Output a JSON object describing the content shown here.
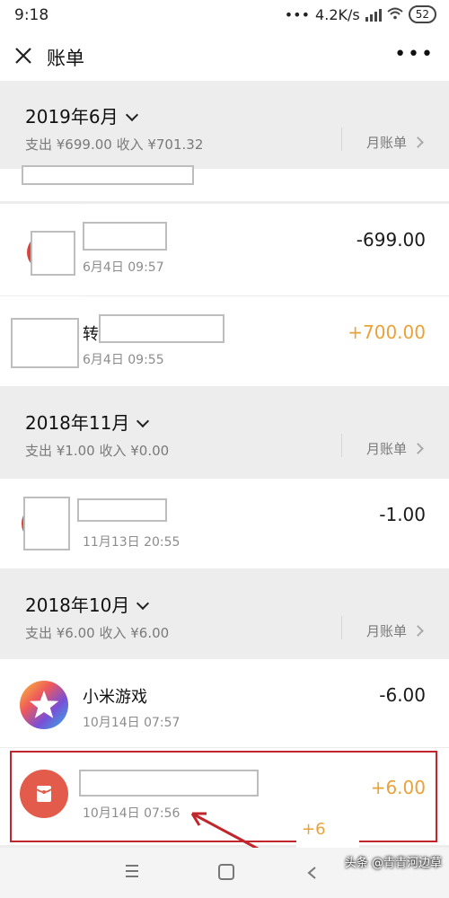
{
  "status": {
    "time": "9:18",
    "speed": "4.2K/s",
    "battery": "52"
  },
  "header": {
    "title": "账单",
    "close_icon": "close-icon",
    "more_icon": "more-icon"
  },
  "groups": [
    {
      "month": "2019年6月",
      "summary": "支出 ¥699.00 收入 ¥701.32",
      "monthly_label": "月账单"
    },
    {
      "month": "2018年11月",
      "summary": "支出 ¥1.00 收入 ¥0.00",
      "monthly_label": "月账单"
    },
    {
      "month": "2018年10月",
      "summary": "支出 ¥6.00 收入 ¥6.00",
      "monthly_label": "月账单"
    }
  ],
  "transactions": [
    {
      "name": "",
      "time": "6月4日 09:57",
      "amount": "-699.00"
    },
    {
      "name": "转",
      "time": "6月4日 09:55",
      "amount": "+700.00"
    },
    {
      "name": "",
      "time": "11月13日 20:55",
      "amount": "-1.00"
    },
    {
      "name": "小米游戏",
      "time": "10月14日 07:57",
      "amount": "-6.00"
    },
    {
      "name": "",
      "time": "10月14日 07:56",
      "amount": "+6.00"
    }
  ],
  "overlay": {
    "plus_fragment": "+6",
    "watermark": "头条 @青青河边草"
  },
  "colors": {
    "income": "#e9a23a",
    "highlight": "#c0262c",
    "red_envelope": "#e35b4a"
  }
}
